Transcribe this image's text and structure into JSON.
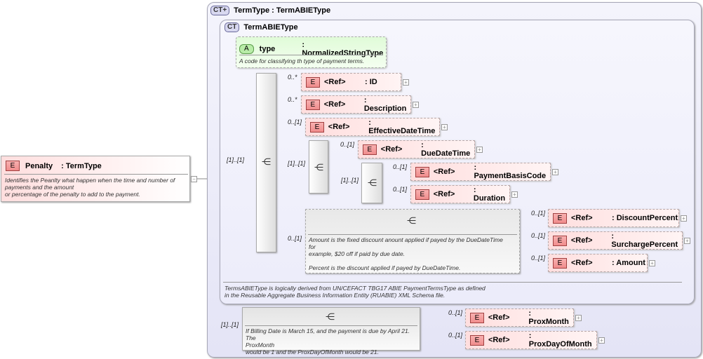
{
  "root": {
    "badge": "E",
    "name": "Penalty",
    "type": ": TermType",
    "doc": [
      "Identifies the Peanlty what happen when the time and number of",
      "payments and the amount",
      "or percentage of the penalty to add to the payment."
    ],
    "collapse": "−"
  },
  "outer": {
    "badge": "CT+",
    "title": "TermType : TermABIEType"
  },
  "inner": {
    "badge": "CT",
    "title": "TermABIEType",
    "doc": [
      "TermsABIEType is logically derived from UN/CEFACT TBG17 ABIE PaymentTermsType as defined",
      "in the Reusable Aggregate Business Information Entity (RUABIE) XML Schema file."
    ]
  },
  "attribute": {
    "badge": "A",
    "name": "type",
    "type": ": NormalizedStringType",
    "doc": "A code for classifying th type of payment terms."
  },
  "cardinalities": {
    "seq1": "[1]..[1]",
    "seq2": "[1]..[1]",
    "seq3": "[1]..[1]",
    "seq4": "0..[1]",
    "seq5": "[1]..[1]"
  },
  "elements": [
    {
      "badge": "E",
      "ref": "<Ref>",
      "name": ": ID",
      "card": "0..*"
    },
    {
      "badge": "E",
      "ref": "<Ref>",
      "name": ": Description",
      "card": "0..*"
    },
    {
      "badge": "E",
      "ref": "<Ref>",
      "name": ": EffectiveDateTime",
      "card": "0..[1]"
    },
    {
      "badge": "E",
      "ref": "<Ref>",
      "name": ": DueDateTime",
      "card": "0..[1]"
    },
    {
      "badge": "E",
      "ref": "<Ref>",
      "name": ": PaymentBasisCode",
      "card": "0..[1]"
    },
    {
      "badge": "E",
      "ref": "<Ref>",
      "name": ": Duration",
      "card": "0..[1]"
    },
    {
      "badge": "E",
      "ref": "<Ref>",
      "name": ": DiscountPercent",
      "card": "0..[1]"
    },
    {
      "badge": "E",
      "ref": "<Ref>",
      "name": ": SurchargePercent",
      "card": "0..[1]"
    },
    {
      "badge": "E",
      "ref": "<Ref>",
      "name": ": Amount",
      "card": "0..[1]"
    },
    {
      "badge": "E",
      "ref": "<Ref>",
      "name": ": ProxMonth",
      "card": "0..[1]"
    },
    {
      "badge": "E",
      "ref": "<Ref>",
      "name": ": ProxDayOfMonth",
      "card": "0..[1]"
    }
  ],
  "seq4_doc": [
    "Amount is the fixed discount anount applied if payed by the DueDateTime",
    "for",
    "example, $20 off if paid by due date.",
    "",
    "Percent is the discount applied if payed by DueDateTime."
  ],
  "seq5_doc": [
    "If Billing Date is March 15, and the payment is due by April 21. The",
    "ProxMonth",
    "would be 1 and the ProxDayOfMonth would be 21."
  ],
  "expand": "+"
}
